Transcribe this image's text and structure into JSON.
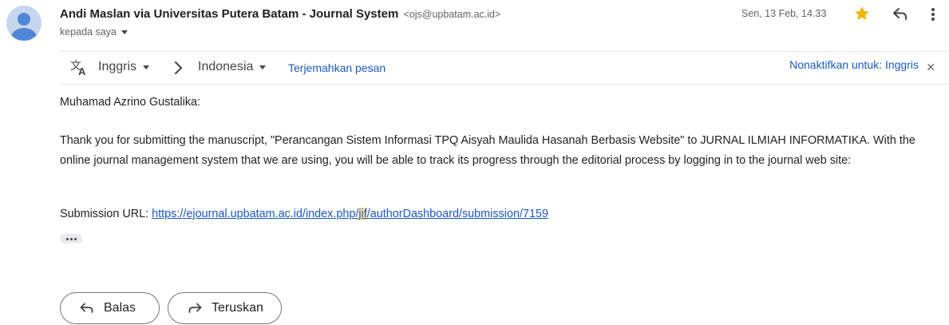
{
  "message": {
    "sender_name": "Andi Maslan via Universitas Putera Batam - Journal System",
    "sender_email": "<ojs@upbatam.ac.id>",
    "recipient_label": "kepada saya",
    "date": "Sen, 13 Feb, 14.33"
  },
  "translate": {
    "source_lang": "Inggris",
    "target_lang": "Indonesia",
    "translate_link": "Terjemahkan pesan",
    "disable_link": "Nonaktifkan untuk: Inggris"
  },
  "body": {
    "greeting": "Muhamad Azrino Gustalika:",
    "paragraph": "Thank you for submitting the manuscript, \"Perancangan Sistem Informasi TPQ Aisyah Maulida Hasanah Berbasis Website\" to JURNAL ILMIAH INFORMATIKA. With the online journal management system that we are using, you will be able to track its progress through the editorial process by logging in to the journal web site:",
    "url_label": "Submission URL: ",
    "url_part1": "https://ejournal.upbatam.ac.id/index.php/",
    "url_highlight": "jif",
    "url_part2": "/authorDashboard/submission/7159"
  },
  "actions": {
    "reply_label": "Balas",
    "forward_label": "Teruskan"
  },
  "colors": {
    "link": "#1a57c9",
    "star": "#f4b400",
    "highlight": "#fbe59a",
    "avatar_bg": "#c6d6ee",
    "avatar_fg": "#4f86d8"
  }
}
